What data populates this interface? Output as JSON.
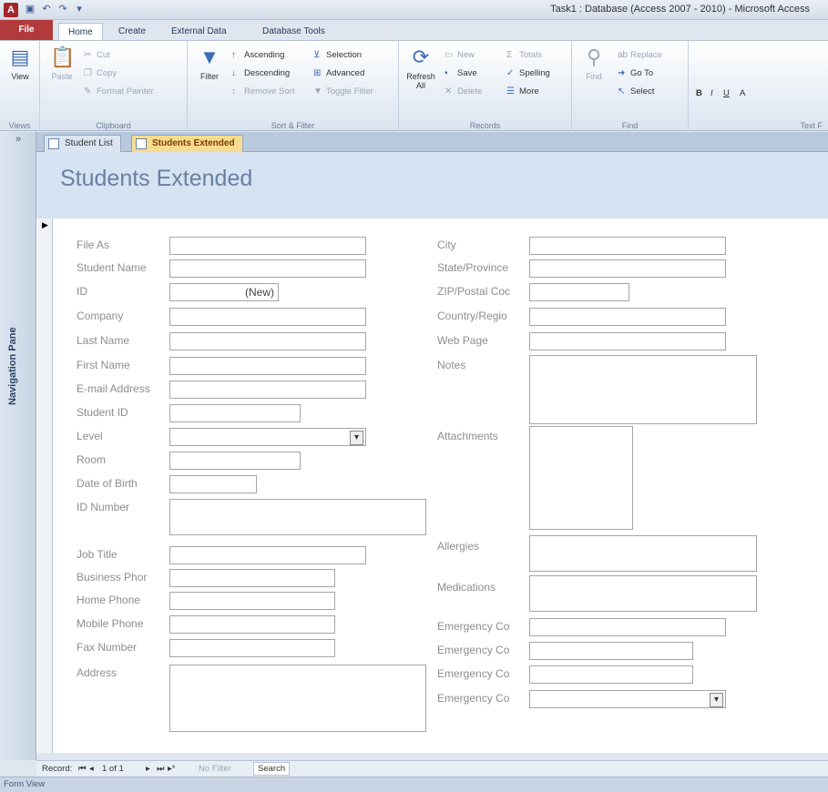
{
  "window": {
    "title": "Task1 : Database (Access 2007 - 2010) - Microsoft Access",
    "app_icon": "A"
  },
  "ribbon_tabs": [
    "File",
    "Home",
    "Create",
    "External Data",
    "Database Tools"
  ],
  "ribbon": {
    "views": {
      "view_label": "View",
      "group": "Views"
    },
    "clipboard": {
      "paste": "Paste",
      "cut": "Cut",
      "copy": "Copy",
      "format_painter": "Format Painter",
      "group": "Clipboard"
    },
    "sort_filter": {
      "filter": "Filter",
      "ascending": "Ascending",
      "descending": "Descending",
      "remove_sort": "Remove Sort",
      "selection": "Selection",
      "advanced": "Advanced",
      "toggle_filter": "Toggle Filter",
      "group": "Sort & Filter"
    },
    "records": {
      "refresh_all": "Refresh All",
      "new": "New",
      "save": "Save",
      "delete": "Delete",
      "totals": "Totals",
      "spelling": "Spelling",
      "more": "More",
      "group": "Records"
    },
    "find": {
      "find": "Find",
      "replace": "Replace",
      "go_to": "Go To",
      "select": "Select",
      "group": "Find"
    },
    "text_formatting": {
      "group": "Text F"
    }
  },
  "nav_pane": {
    "label": "Navigation Pane"
  },
  "doc_tabs": [
    "Student List",
    "Students Extended"
  ],
  "form": {
    "title": "Students Extended",
    "left_fields": [
      {
        "label": "File As",
        "value": ""
      },
      {
        "label": "Student Name",
        "value": ""
      },
      {
        "label": "ID",
        "value": "(New)"
      },
      {
        "label": "Company",
        "value": ""
      },
      {
        "label": "Last Name",
        "value": ""
      },
      {
        "label": "First Name",
        "value": ""
      },
      {
        "label": "E-mail Address",
        "value": ""
      },
      {
        "label": "Student ID",
        "value": ""
      },
      {
        "label": "Level",
        "value": ""
      },
      {
        "label": "Room",
        "value": ""
      },
      {
        "label": "Date of Birth",
        "value": ""
      },
      {
        "label": "ID Number",
        "value": ""
      },
      {
        "label": "Job Title",
        "value": ""
      },
      {
        "label": "Business Phor",
        "value": ""
      },
      {
        "label": "Home Phone",
        "value": ""
      },
      {
        "label": "Mobile Phone",
        "value": ""
      },
      {
        "label": "Fax Number",
        "value": ""
      },
      {
        "label": "Address",
        "value": ""
      }
    ],
    "right_fields": [
      {
        "label": "City",
        "value": ""
      },
      {
        "label": "State/Province",
        "value": ""
      },
      {
        "label": "ZIP/Postal Coc",
        "value": ""
      },
      {
        "label": "Country/Regio",
        "value": ""
      },
      {
        "label": "Web Page",
        "value": ""
      },
      {
        "label": "Notes",
        "value": ""
      },
      {
        "label": "Attachments",
        "value": ""
      },
      {
        "label": "Allergies",
        "value": ""
      },
      {
        "label": "Medications",
        "value": ""
      },
      {
        "label": "Emergency Co",
        "value": ""
      },
      {
        "label": "Emergency Co",
        "value": ""
      },
      {
        "label": "Emergency Co",
        "value": ""
      },
      {
        "label": "Emergency Co",
        "value": ""
      }
    ]
  },
  "record_nav": {
    "record_label": "Record:",
    "position": "1 of 1",
    "filter": "No Filter",
    "search": "Search"
  },
  "status_bar": {
    "view": "Form View"
  }
}
